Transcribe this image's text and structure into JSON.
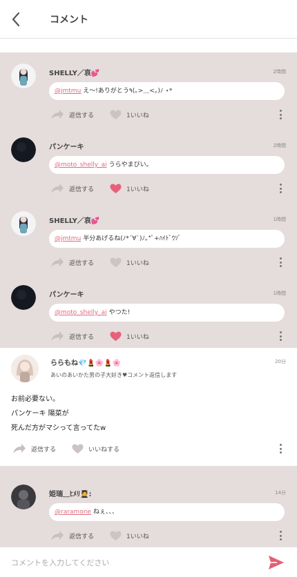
{
  "header": {
    "title": "コメント"
  },
  "colors": {
    "accent": "#e85c74",
    "pinkText": "#e06b7c",
    "bg": "#e5dcdc",
    "likeInactive": "#cdc3c3",
    "likeActive": "#e8607a"
  },
  "replies_top": [
    {
      "name": "SHELLY／哀💕",
      "time": "2時間",
      "mention": "@jmtmu",
      "text": "え〜!ありがとう٩(｡>＿<｡)ﾉ ⋆*",
      "reply_label": "返信する",
      "like_label": "1いいね",
      "liked": false,
      "avatar": "avatar-shelly"
    },
    {
      "name": "パンケーキ",
      "time": "2時間",
      "mention": "@moto_shelly_ai",
      "text": "うらやまびい。",
      "reply_label": "返信する",
      "like_label": "1いいね",
      "liked": true,
      "avatar": "avatar-dark"
    },
    {
      "name": "SHELLY／哀💕",
      "time": "1時間",
      "mention": "@jmtmu",
      "text": "半分あげるね(ﾉ*´∀`)ﾉ｡*ﾟ+ﾊｲﾄﾞｳｿﾞ",
      "reply_label": "返信する",
      "like_label": "1いいね",
      "liked": false,
      "avatar": "avatar-shelly"
    },
    {
      "name": "パンケーキ",
      "time": "1時間",
      "mention": "@moto_shelly_ai",
      "text": "やつた!",
      "reply_label": "返信する",
      "like_label": "1いいね",
      "liked": true,
      "avatar": "avatar-dark"
    }
  ],
  "main_comment": {
    "name": "ららもね💎💄🌸💄🌸",
    "time": "20分",
    "subtitle": "あいのあいかた男の子大好き♥コメント返信します",
    "lines": [
      "お前必要ない。",
      "パンケーキ 陽菜が",
      "死んだ方がマシって言ってたw"
    ],
    "reply_label": "返信する",
    "like_label": "いいねする"
  },
  "reply_bottom": {
    "name": "姫瑞＿ﾋﾒﾘ🧑‍🎓:",
    "time": "14分",
    "mention": "@raramone",
    "text": "ねぇ、、、",
    "reply_label": "返信する",
    "like_label": "1いいね"
  },
  "footer": {
    "placeholder": "コメントを入力してください"
  }
}
